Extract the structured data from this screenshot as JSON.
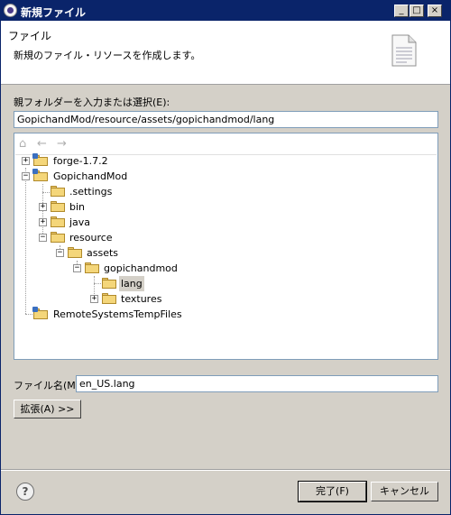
{
  "window": {
    "title": "新規ファイル",
    "min_glyph": "_",
    "max_glyph": "□",
    "close_glyph": "×"
  },
  "header": {
    "title": "ファイル",
    "description": "新規のファイル・リソースを作成します。"
  },
  "parent_folder": {
    "label": "親フォルダーを入力または選択(E):",
    "value": "GopichandMod/resource/assets/gopichandmod/lang"
  },
  "tree_nav": {
    "home_icon": "⌂",
    "back_icon": "←",
    "forward_icon": "→"
  },
  "tree": {
    "items": [
      {
        "label": "forge-1.7.2",
        "expander": "+"
      },
      {
        "label": "GopichandMod",
        "expander": "−"
      },
      {
        "label": ".settings"
      },
      {
        "label": "bin",
        "expander": "+"
      },
      {
        "label": "java",
        "expander": "+"
      },
      {
        "label": "resource",
        "expander": "−"
      },
      {
        "label": "assets",
        "expander": "−"
      },
      {
        "label": "gopichandmod",
        "expander": "−"
      },
      {
        "label": "lang",
        "selected": true
      },
      {
        "label": "textures",
        "expander": "+"
      },
      {
        "label": "RemoteSystemsTempFiles"
      }
    ]
  },
  "file_name": {
    "label": "ファイル名(M):",
    "value": "en_US.lang"
  },
  "advanced_button": "拡張(A) >>",
  "help_glyph": "?",
  "buttons": {
    "finish": "完了(F)",
    "cancel": "キャンセル"
  }
}
